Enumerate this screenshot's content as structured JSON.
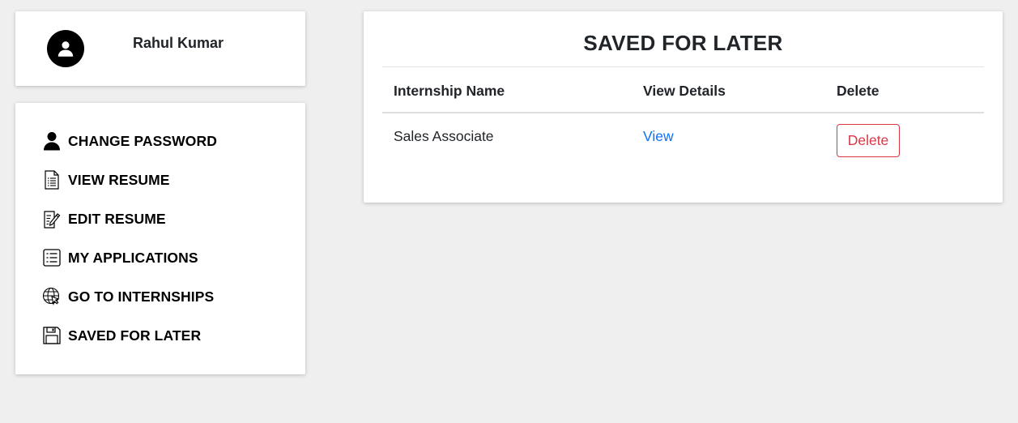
{
  "profile": {
    "name": "Rahul Kumar",
    "avatar_icon": "user-avatar-icon"
  },
  "menu": {
    "items": [
      {
        "label": "CHANGE PASSWORD",
        "icon": "person-icon"
      },
      {
        "label": "VIEW RESUME",
        "icon": "document-icon"
      },
      {
        "label": "EDIT RESUME",
        "icon": "edit-document-icon"
      },
      {
        "label": "MY APPLICATIONS",
        "icon": "list-icon"
      },
      {
        "label": "GO TO INTERNSHIPS",
        "icon": "globe-cursor-icon"
      },
      {
        "label": "SAVED FOR LATER",
        "icon": "floppy-disk-icon"
      }
    ]
  },
  "main": {
    "title": "SAVED FOR LATER",
    "table": {
      "headers": [
        "Internship Name",
        "View Details",
        "Delete"
      ],
      "rows": [
        {
          "name": "Sales Associate",
          "view": "View",
          "delete": "Delete"
        }
      ]
    }
  },
  "colors": {
    "background": "#efefef",
    "link": "#0d6efd",
    "danger": "#dc3545"
  }
}
